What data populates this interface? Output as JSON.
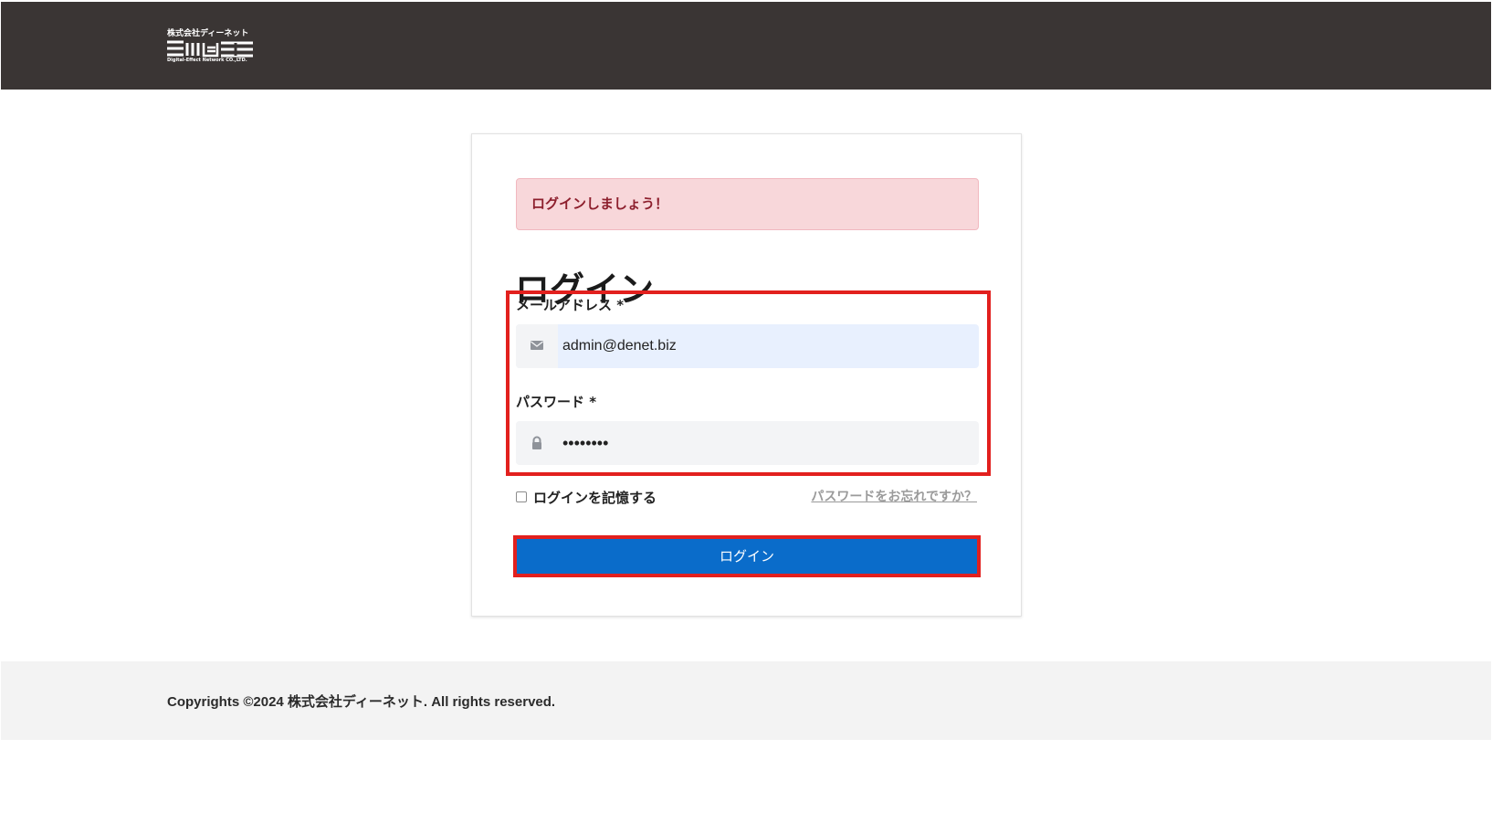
{
  "header": {
    "logo_text_top": "株式会社ディーネット",
    "logo_text_bottom": "Digital-Effect Network CO.,LTD."
  },
  "login": {
    "alert": "ログインしましょう！",
    "title": "ログイン",
    "email_label": "メールアドレス *",
    "email_value": "admin@denet.biz",
    "password_label": "パスワード *",
    "password_value": "••••••••",
    "remember_label": "ログインを記憶する",
    "forgot_link": "パスワードをお忘れですか？",
    "submit_label": "ログイン",
    "remember_checked": false
  },
  "footer": {
    "copyright": "Copyrights ©2024 株式会社ディーネット. All rights reserved."
  },
  "icons": {
    "email": "mail-icon",
    "password": "lock-icon"
  },
  "colors": {
    "header_background": "#3a3534",
    "button_blue": "#0a6cca",
    "alert_background": "#f8d7da",
    "alert_text": "#8d1f2d",
    "highlight_red": "#e2201e"
  }
}
